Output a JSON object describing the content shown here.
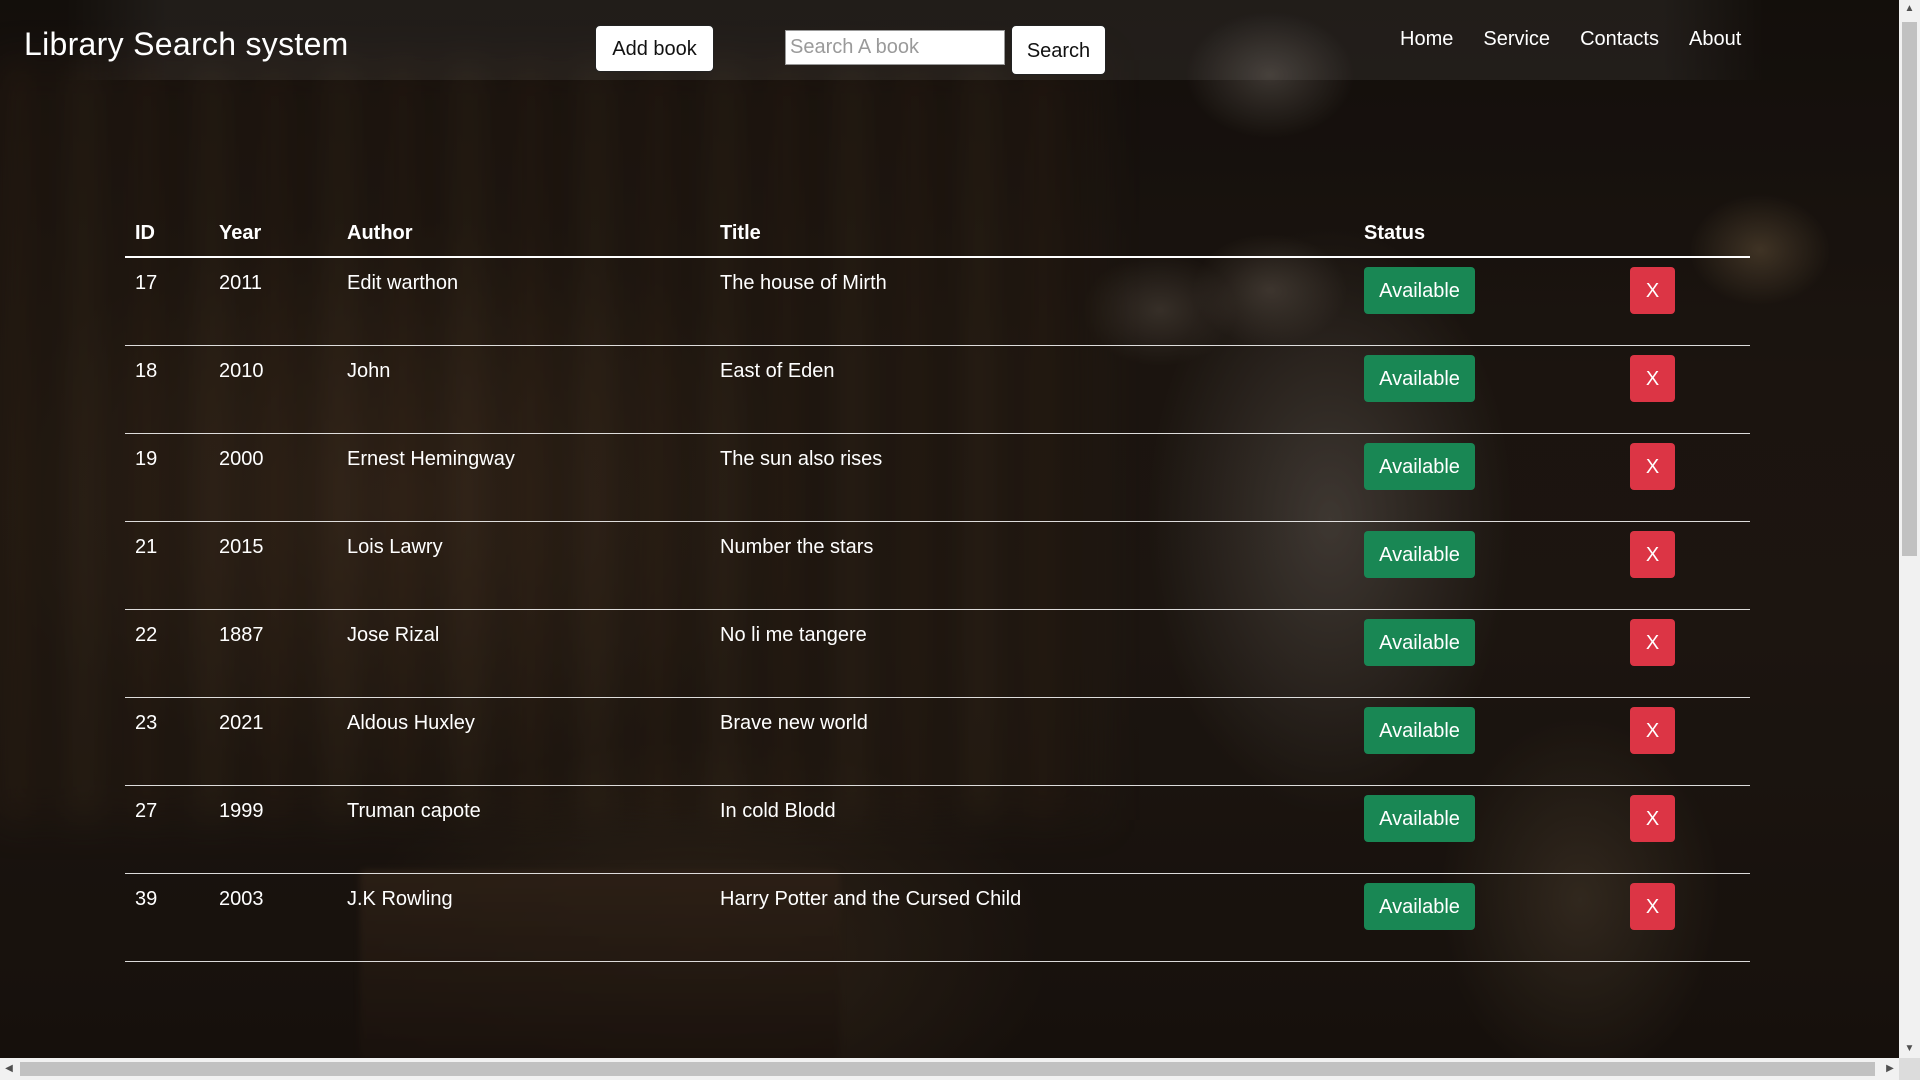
{
  "header": {
    "brand": "Library Search system",
    "add_book_label": "Add book",
    "search_placeholder": "Search A book",
    "search_value": "",
    "search_button_label": "Search",
    "nav": [
      "Home",
      "Service",
      "Contacts",
      "About"
    ]
  },
  "table": {
    "columns": [
      "ID",
      "Year",
      "Author",
      "Title",
      "Status"
    ],
    "rows": [
      {
        "id": "17",
        "year": "2011",
        "author": "Edit warthon",
        "title": "The house of Mirth",
        "status": "Available",
        "delete": "X"
      },
      {
        "id": "18",
        "year": "2010",
        "author": "John",
        "title": "East of Eden",
        "status": "Available",
        "delete": "X"
      },
      {
        "id": "19",
        "year": "2000",
        "author": "Ernest Hemingway",
        "title": "The sun also rises",
        "status": "Available",
        "delete": "X"
      },
      {
        "id": "21",
        "year": "2015",
        "author": "Lois Lawry",
        "title": "Number the stars",
        "status": "Available",
        "delete": "X"
      },
      {
        "id": "22",
        "year": "1887",
        "author": "Jose Rizal",
        "title": "No li me tangere",
        "status": "Available",
        "delete": "X"
      },
      {
        "id": "23",
        "year": "2021",
        "author": "Aldous Huxley",
        "title": "Brave new world",
        "status": "Available",
        "delete": "X"
      },
      {
        "id": "27",
        "year": "1999",
        "author": "Truman capote",
        "title": "In cold Blodd",
        "status": "Available",
        "delete": "X"
      },
      {
        "id": "39",
        "year": "2003",
        "author": "J.K Rowling",
        "title": "Harry Potter and the Cursed Child",
        "status": "Available",
        "delete": "X"
      }
    ]
  },
  "colors": {
    "status_available": "#198754",
    "delete": "#dc3545"
  }
}
